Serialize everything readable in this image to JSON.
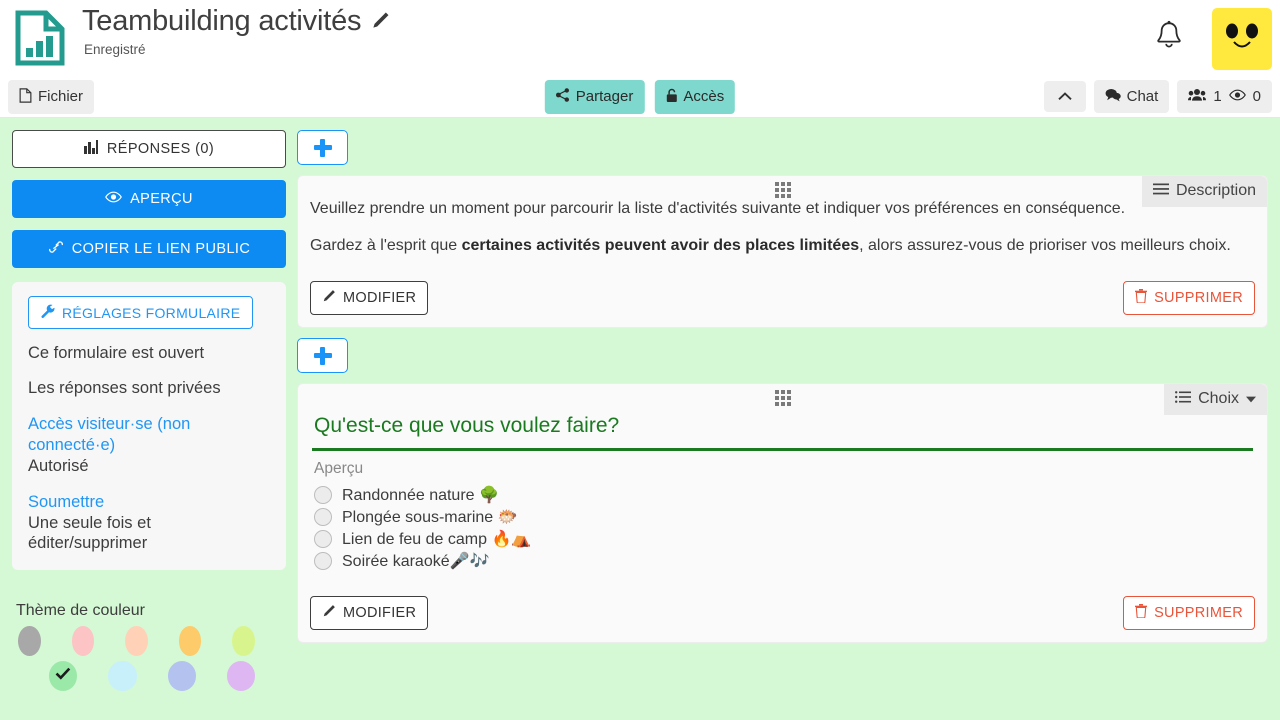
{
  "header": {
    "logo_icon": "document-chart-icon",
    "title": "Teambuilding activités",
    "edit_icon": "pencil-icon",
    "status": "Enregistré",
    "bell_icon": "bell-icon",
    "avatar_icon": "smiley-avatar"
  },
  "toolbar": {
    "file_label": "Fichier",
    "file_icon": "file-icon",
    "share_label": "Partager",
    "share_icon": "share-icon",
    "access_label": "Accès",
    "access_icon": "lock-icon",
    "collapse_icon": "chevron-up-icon",
    "chat_label": "Chat",
    "chat_icon": "chat-icon",
    "users_icon": "users-icon",
    "users_count": "1",
    "views_icon": "eye-icon",
    "views_count": "0"
  },
  "sidebar": {
    "responses_label": "RÉPONSES (0)",
    "responses_icon": "bar-chart-icon",
    "preview_label": "APERÇU",
    "preview_icon": "eye-icon",
    "copy_link_label": "COPIER LE LIEN PUBLIC",
    "copy_link_icon": "link-icon",
    "settings_button_label": "RÉGLAGES FORMULAIRE",
    "settings_button_icon": "wrench-icon",
    "status_open": "Ce formulaire est ouvert",
    "status_private": "Les réponses sont privées",
    "guest_access_link": "Accès visiteur·se (non connecté·e)",
    "guest_access_value": "Autorisé",
    "submit_link": "Soumettre",
    "submit_value": "Une seule fois et éditer/supprimer",
    "theme_title": "Thème de couleur",
    "theme_colors": [
      {
        "name": "gray",
        "hex": "#a8a8a8",
        "selected": false
      },
      {
        "name": "pink",
        "hex": "#fcc4c4",
        "selected": false
      },
      {
        "name": "peach",
        "hex": "#ffd2b8",
        "selected": false
      },
      {
        "name": "orange",
        "hex": "#fdcb69",
        "selected": false
      },
      {
        "name": "lime",
        "hex": "#d8f58d",
        "selected": false
      },
      {
        "name": "green",
        "hex": "#9be9a8",
        "selected": true
      },
      {
        "name": "cyan",
        "hex": "#c7f0fb",
        "selected": false
      },
      {
        "name": "blue",
        "hex": "#b4c2f0",
        "selected": false
      },
      {
        "name": "violet",
        "hex": "#ddb6f2",
        "selected": false
      }
    ],
    "check_icon": "check-icon"
  },
  "main": {
    "add_button_icon": "plus-icon",
    "drag_handle_icon": "drag-grid-icon",
    "cards": [
      {
        "type_label": "Description",
        "type_icon": "lines-icon",
        "paragraph_1": "Veuillez prendre un moment pour parcourir la liste d'activités suivante et indiquer vos préférences en conséquence.",
        "paragraph_2_pre": "Gardez à l'esprit que ",
        "paragraph_2_bold": "certaines activités peuvent avoir des places limitées",
        "paragraph_2_post": ", alors assurez-vous de prioriser vos meilleurs choix.",
        "modify_label": "MODIFIER",
        "modify_icon": "pencil-icon",
        "delete_label": "SUPPRIMER",
        "delete_icon": "trash-icon"
      },
      {
        "type_label": "Choix",
        "type_icon": "list-icon",
        "type_caret_icon": "caret-down-icon",
        "question": "Qu'est-ce que vous voulez faire?",
        "preview_label": "Aperçu",
        "options": [
          "Randonnée nature 🌳",
          "Plongée sous-marine 🐡",
          "Lien de feu de camp 🔥⛺",
          "Soirée karaoké🎤🎶"
        ],
        "modify_label": "MODIFIER",
        "modify_icon": "pencil-icon",
        "delete_label": "SUPPRIMER",
        "delete_icon": "trash-icon"
      }
    ]
  },
  "colors": {
    "page_background": "#d5f8d5",
    "accent_teal": "#7fd8cd",
    "accent_blue": "#0d8bf2",
    "question_green": "#1a7a1f",
    "delete_red": "#e8553a",
    "avatar_yellow": "#ffe93f"
  }
}
